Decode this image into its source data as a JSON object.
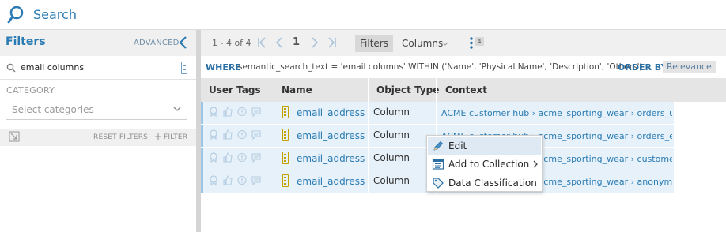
{
  "topbar": {
    "search_label": "Search"
  },
  "left_panel": {
    "title": "Filters",
    "advanced_label": "ADVANCED",
    "search_value": "email columns",
    "category_label": "CATEGORY",
    "category_placeholder": "Select categories",
    "reset_filters_label": "RESET FILTERS",
    "add_filter_label": "FILTER"
  },
  "toolbar": {
    "range": "1 - 4 of 4",
    "page": "1",
    "filters_label": "Filters",
    "columns_label": "Columns",
    "more_badge": "4"
  },
  "query": {
    "where_keyword": "WHERE",
    "text": "semantic_search_text = 'email columns' WITHIN ('Name', 'Physical Name', 'Description', 'Others')",
    "order_keyword": "ORDER BY",
    "order_value": "Relevance"
  },
  "table": {
    "headers": [
      "User Tags",
      "Name",
      "Object Type",
      "Context"
    ],
    "rows": [
      {
        "name": "email_address",
        "type": "Column",
        "context": "ACME customer hub › acme_sporting_wear › orders_us"
      },
      {
        "name": "email_address",
        "type": "Column",
        "context": "ACME customer hub › acme_sporting_wear › orders_eu"
      },
      {
        "name": "email_address",
        "type": "Column",
        "context": "ACME customer hub › acme_sporting_wear › customers"
      },
      {
        "name": "email_address",
        "type": "Column",
        "context": "ACME customer hub › acme_sporting_wear › anonymized_"
      }
    ]
  },
  "context_menu": {
    "items": [
      {
        "label": "Edit",
        "icon": "pencil-icon"
      },
      {
        "label": "Add to Collection",
        "icon": "collection-icon"
      },
      {
        "label": "Data Classification",
        "icon": "tag-icon"
      }
    ]
  },
  "colors": {
    "accent": "#2a7bb3",
    "row_highlight": "#e6f1fa",
    "menu_highlight": "#dfe9f3"
  }
}
